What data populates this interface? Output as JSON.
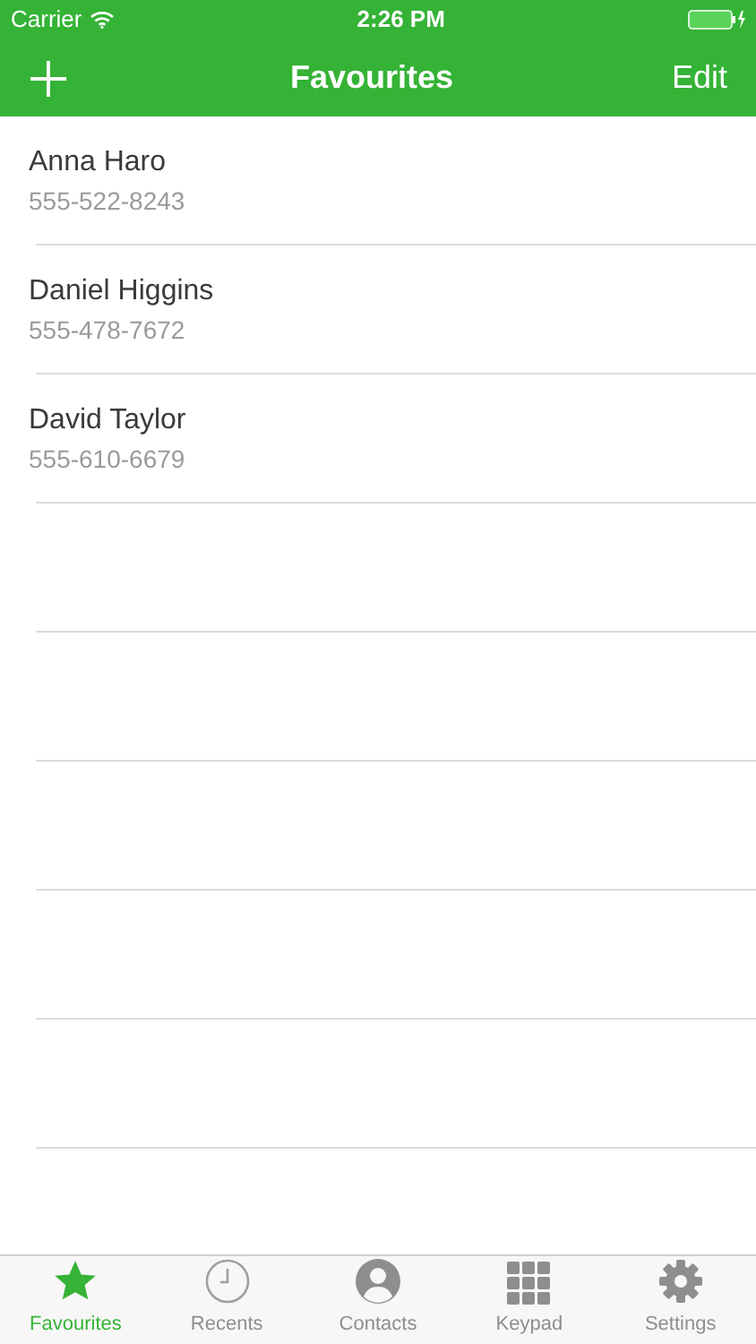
{
  "status_bar": {
    "carrier": "Carrier",
    "time": "2:26 PM"
  },
  "nav": {
    "title": "Favourites",
    "right_button": "Edit"
  },
  "contacts": [
    {
      "name": "Anna Haro",
      "phone": "555-522-8243"
    },
    {
      "name": "Daniel Higgins",
      "phone": "555-478-7672"
    },
    {
      "name": "David Taylor",
      "phone": "555-610-6679"
    }
  ],
  "tabs": [
    {
      "label": "Favourites",
      "kind": "star",
      "selected": true
    },
    {
      "label": "Recents",
      "kind": "clock",
      "selected": false
    },
    {
      "label": "Contacts",
      "kind": "person",
      "selected": false
    },
    {
      "label": "Keypad",
      "kind": "grid",
      "selected": false
    },
    {
      "label": "Settings",
      "kind": "gear",
      "selected": false
    }
  ]
}
